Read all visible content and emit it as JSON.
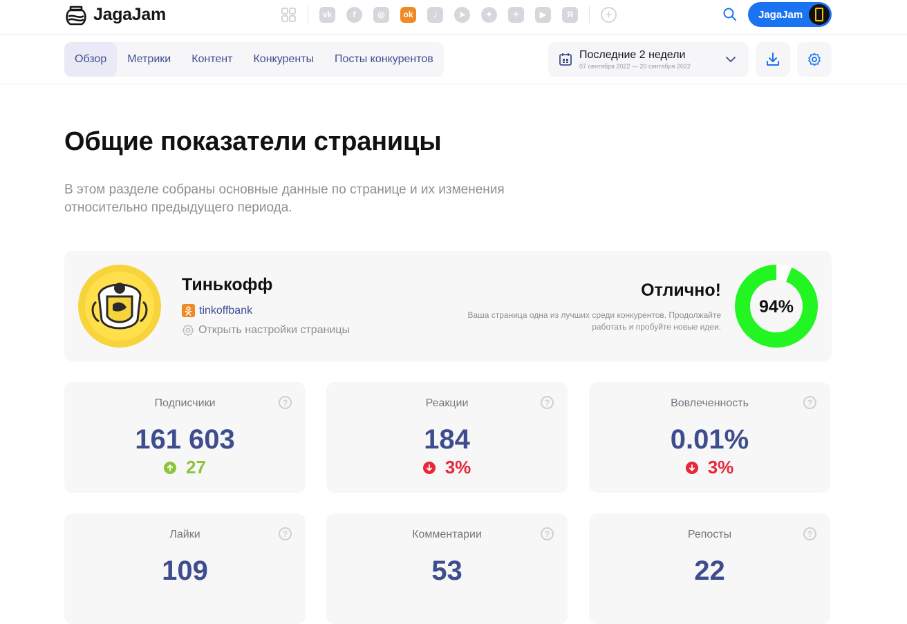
{
  "brand": {
    "name": "JagaJam"
  },
  "socials": [
    {
      "name": "vk",
      "glyph": "vk"
    },
    {
      "name": "facebook",
      "glyph": "f"
    },
    {
      "name": "instagram",
      "glyph": "◎"
    },
    {
      "name": "odnoklassniki",
      "glyph": "ok"
    },
    {
      "name": "tiktok",
      "glyph": "♪"
    },
    {
      "name": "telegram",
      "glyph": "➤"
    },
    {
      "name": "twitter",
      "glyph": "✦"
    },
    {
      "name": "zen",
      "glyph": "✧"
    },
    {
      "name": "youtube",
      "glyph": "▶"
    },
    {
      "name": "yappy",
      "glyph": "Я"
    }
  ],
  "account": {
    "label": "JagaJam"
  },
  "tabs": [
    {
      "label": "Обзор",
      "active": true
    },
    {
      "label": "Метрики",
      "active": false
    },
    {
      "label": "Контент",
      "active": false
    },
    {
      "label": "Конкуренты",
      "active": false
    },
    {
      "label": "Посты конкурентов",
      "active": false
    }
  ],
  "period": {
    "title": "Последние 2 недели",
    "range": "07 сентября 2022 — 20 сентября 2022"
  },
  "page": {
    "title": "Общие показатели страницы",
    "description": "В этом разделе собраны основные данные по странице и их изменения относительно предыдущего периода."
  },
  "profile": {
    "name": "Тинькофф",
    "handle": "tinkoffbank",
    "settings_link": "Открыть настройки страницы",
    "rating_title": "Отлично!",
    "rating_text": "Ваша страница одна из лучших среди конкурентов. Продолжайте работать и пробуйте новые идеи.",
    "score_label": "94%",
    "score_value": 94,
    "score_color": "#22f522"
  },
  "stats": [
    {
      "label": "Подписчики",
      "value": "161 603",
      "delta": "27",
      "trend": "up"
    },
    {
      "label": "Реакции",
      "value": "184",
      "delta": "3%",
      "trend": "down"
    },
    {
      "label": "Вовлеченность",
      "value": "0.01%",
      "delta": "3%",
      "trend": "down"
    },
    {
      "label": "Лайки",
      "value": "109",
      "delta": "",
      "trend": ""
    },
    {
      "label": "Комментарии",
      "value": "53",
      "delta": "",
      "trend": ""
    },
    {
      "label": "Репосты",
      "value": "22",
      "delta": "",
      "trend": ""
    }
  ],
  "colors": {
    "accent": "#1a73f0",
    "link": "#3f4d8f",
    "positive": "#8ec43a",
    "negative": "#e5283a"
  }
}
